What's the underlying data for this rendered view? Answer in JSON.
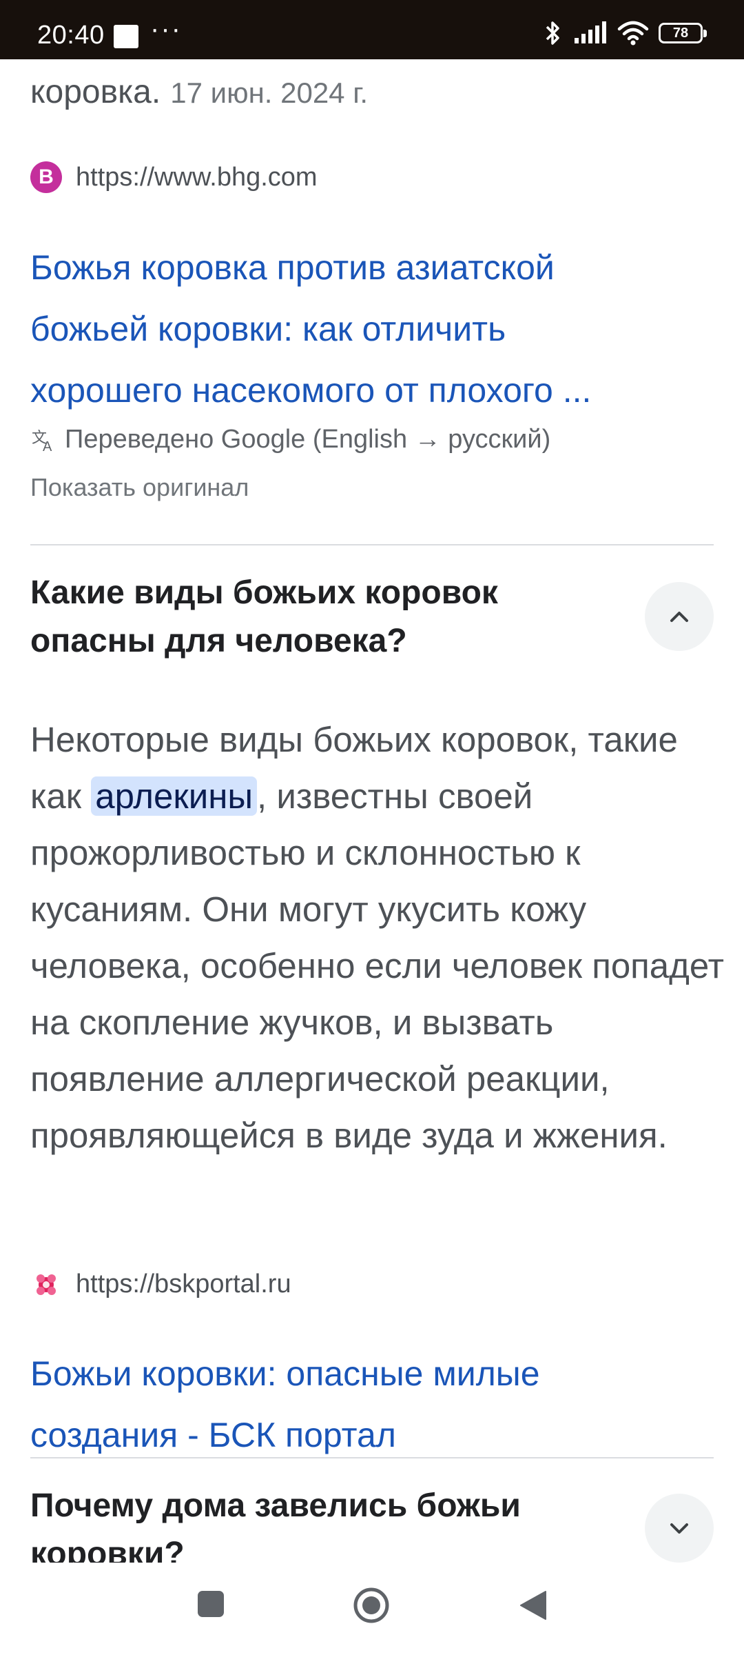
{
  "status_bar": {
    "time": "20:40",
    "more": "···",
    "battery": "78"
  },
  "snippet_tail": {
    "text": "коровка.",
    "date": "17 июн. 2024 г."
  },
  "result1": {
    "favicon_letter": "B",
    "url": "https://www.bhg.com",
    "title_lines": [
      "Божья коровка против азиатской",
      "божьей коровки: как отличить",
      "хорошего насекомого от плохого ..."
    ],
    "translated": "Переведено Google (English → русский)",
    "show_original": "Показать оригинал"
  },
  "faq1": {
    "question": "Какие виды божьих коровок опасны для человека?",
    "answer_before": "Некоторые виды божьих коровок, такие как ",
    "answer_highlight": "арлекины",
    "answer_after": ", известны своей прожорливостью и склонностью к кусаниям. Они могут укусить кожу человека, особенно если человек попадет на скопление жучков, и вызвать появление аллергической реакции, проявляющейся в виде зуда и жжения."
  },
  "result2": {
    "url": "https://bskportal.ru",
    "title_lines": [
      "Божьи коровки: опасные милые",
      "создания - БСК портал"
    ]
  },
  "faq2": {
    "question": "Почему дома завелись божьи коровки?"
  },
  "colors": {
    "link": "#1a55b8",
    "highlight": "#d3e3fd",
    "bhg_favicon": "#c42f9c"
  }
}
